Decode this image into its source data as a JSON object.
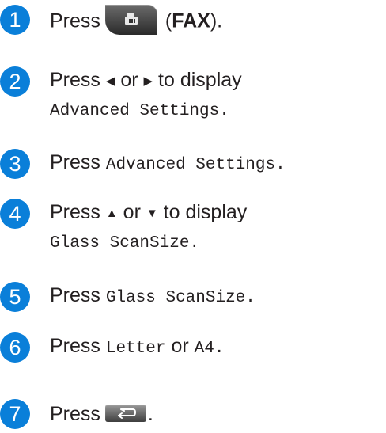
{
  "steps": [
    {
      "number": "1",
      "press": "Press",
      "key_name": "FAX",
      "open_paren": "(",
      "close_paren": ")."
    },
    {
      "number": "2",
      "press": "Press",
      "or": "or",
      "to_display": "to display",
      "setting": "Advanced Settings",
      "period": "."
    },
    {
      "number": "3",
      "press": "Press",
      "setting": "Advanced Settings",
      "period": "."
    },
    {
      "number": "4",
      "press": "Press",
      "or": "or",
      "to_display": "to display",
      "setting": "Glass ScanSize",
      "period": "."
    },
    {
      "number": "5",
      "press": "Press",
      "setting": "Glass ScanSize",
      "period": "."
    },
    {
      "number": "6",
      "press": "Press",
      "option1": "Letter",
      "or": "or",
      "option2": "A4",
      "period": "."
    },
    {
      "number": "7",
      "press": "Press",
      "period": "."
    }
  ],
  "arrows": {
    "left": "◀",
    "right": "▶",
    "up": "▲",
    "down": "▼"
  },
  "icons": {
    "fax_key": "fax-machine-icon",
    "back_key": "back-arrow-icon"
  },
  "colors": {
    "step_badge": "#0a7fd9",
    "text": "#231f20"
  }
}
